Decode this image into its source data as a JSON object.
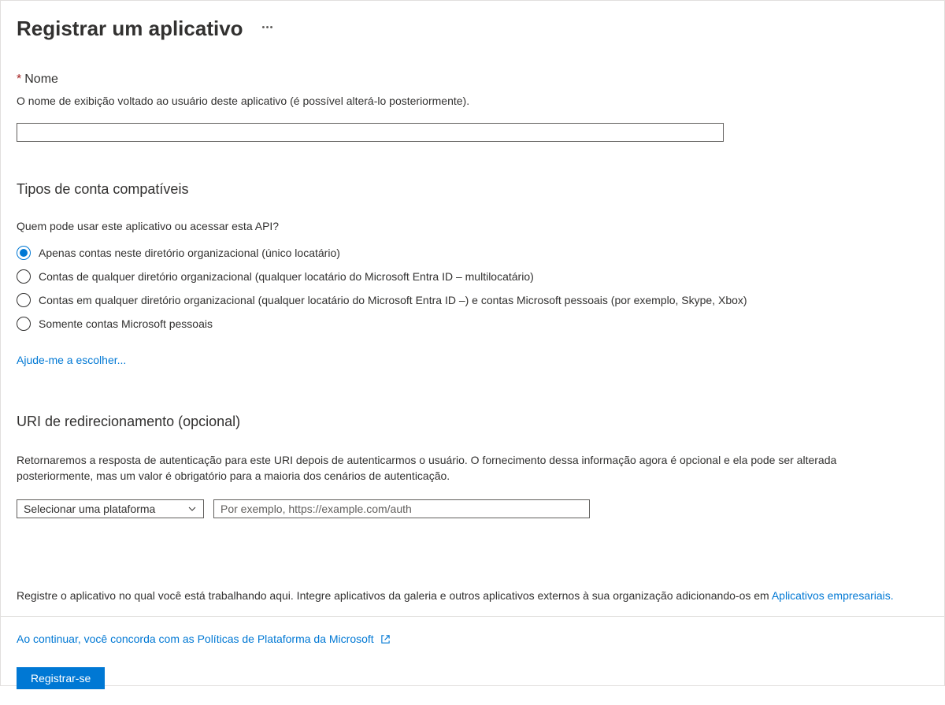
{
  "header": {
    "title": "Registrar um aplicativo"
  },
  "nameSection": {
    "label": "Nome",
    "description": "O nome de exibição voltado ao usuário deste aplicativo (é possível alterá-lo posteriormente).",
    "value": ""
  },
  "accountTypes": {
    "title": "Tipos de conta compatíveis",
    "subtext": "Quem pode usar este aplicativo ou acessar esta API?",
    "options": [
      {
        "label": "Apenas contas neste diretório organizacional (único locatário)",
        "selected": true
      },
      {
        "label": "Contas de qualquer diretório organizacional (qualquer locatário do Microsoft Entra ID – multilocatário)",
        "selected": false
      },
      {
        "label": "Contas em qualquer diretório organizacional (qualquer locatário do Microsoft Entra ID –) e contas Microsoft pessoais (por exemplo, Skype, Xbox)",
        "selected": false
      },
      {
        "label": "Somente contas Microsoft pessoais",
        "selected": false
      }
    ],
    "helpLink": "Ajude-me a escolher..."
  },
  "redirectUri": {
    "title": "URI de redirecionamento (opcional)",
    "description": "Retornaremos a resposta de autenticação para este URI depois de autenticarmos o usuário. O fornecimento dessa informação agora é opcional e ela pode ser alterada posteriormente, mas um valor é obrigatório para a maioria dos cenários de autenticação.",
    "platformPlaceholder": "Selecionar uma plataforma",
    "uriPlaceholder": "Por exemplo, https://example.com/auth"
  },
  "footer": {
    "notePrefix": "Registre o aplicativo no qual você está trabalhando aqui. Integre aplicativos da galeria e outros aplicativos externos à sua organização adicionando-os em ",
    "noteLink": "Aplicativos empresariais.",
    "policyLink": "Ao continuar, você concorda com as Políticas de Plataforma da Microsoft",
    "registerButton": "Registrar-se"
  }
}
